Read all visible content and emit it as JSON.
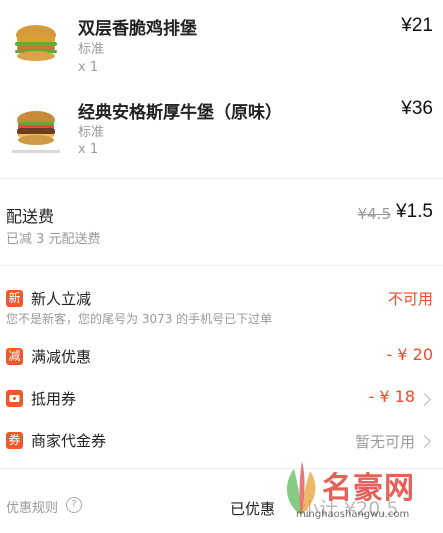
{
  "order_items": [
    {
      "name": "双层香脆鸡排堡",
      "spec": "标准",
      "qty": "x 1",
      "price": "¥21"
    },
    {
      "name": "经典安格斯厚牛堡（原味）",
      "spec": "标准",
      "qty": "x 1",
      "price": "¥36"
    }
  ],
  "delivery": {
    "label": "配送费",
    "original_price": "¥4.5",
    "price": "¥1.5",
    "note": "已减 3 元配送费"
  },
  "promotions": [
    {
      "icon_char": "新",
      "label": "新人立减",
      "value": "不可用",
      "sub": "您不是新客，您的尾号为 3073 的手机号已下过单",
      "icon": "new-user-icon"
    },
    {
      "icon_char": "减",
      "label": "满减优惠",
      "value": "- ¥ 20",
      "icon": "discount-icon"
    },
    {
      "label": "抵用券",
      "value": "- ¥ 18",
      "icon": "coupon-icon"
    },
    {
      "icon_char": "券",
      "label": "商家代金券",
      "value": "暂无可用",
      "icon": "voucher-icon"
    }
  ],
  "footer": {
    "rules_label": "优惠规则",
    "saved_label": "已优惠",
    "total_text": "小计 ¥20.5"
  },
  "watermark": {
    "text": "名豪网",
    "sub": "minghaoshangwu.com"
  },
  "colors": {
    "accent": "#f05a2a",
    "price_red": "#f04a2a"
  }
}
